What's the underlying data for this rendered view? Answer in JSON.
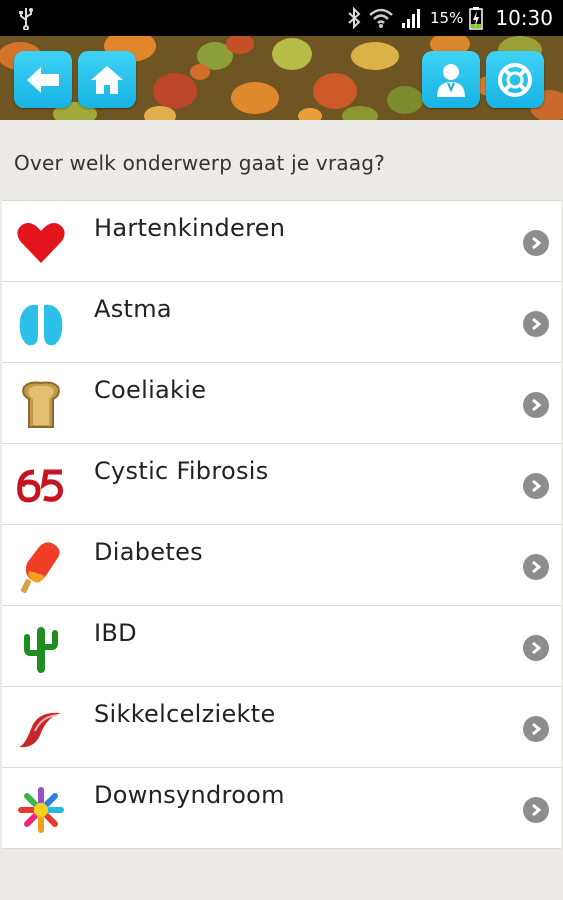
{
  "status_bar": {
    "battery_percent": "15%",
    "time": "10:30"
  },
  "header": {
    "back_icon": "arrow-left-icon",
    "home_icon": "home-icon",
    "profile_icon": "doctor-icon",
    "info_icon": "help-lifebuoy-icon",
    "button_color": "#1ec0ee"
  },
  "prompt": "Over welk onderwerp gaat je vraag?",
  "topics": [
    {
      "label": "Hartenkinderen",
      "icon": "heart-icon"
    },
    {
      "label": "Astma",
      "icon": "lungs-icon"
    },
    {
      "label": "Coeliakie",
      "icon": "bread-icon"
    },
    {
      "label": "Cystic Fibrosis",
      "icon": "65-roses-icon"
    },
    {
      "label": "Diabetes",
      "icon": "popsicle-icon"
    },
    {
      "label": "IBD",
      "icon": "cactus-icon"
    },
    {
      "label": "Sikkelcelziekte",
      "icon": "sickle-cell-icon"
    },
    {
      "label": "Downsyndroom",
      "icon": "star-flower-icon"
    }
  ]
}
